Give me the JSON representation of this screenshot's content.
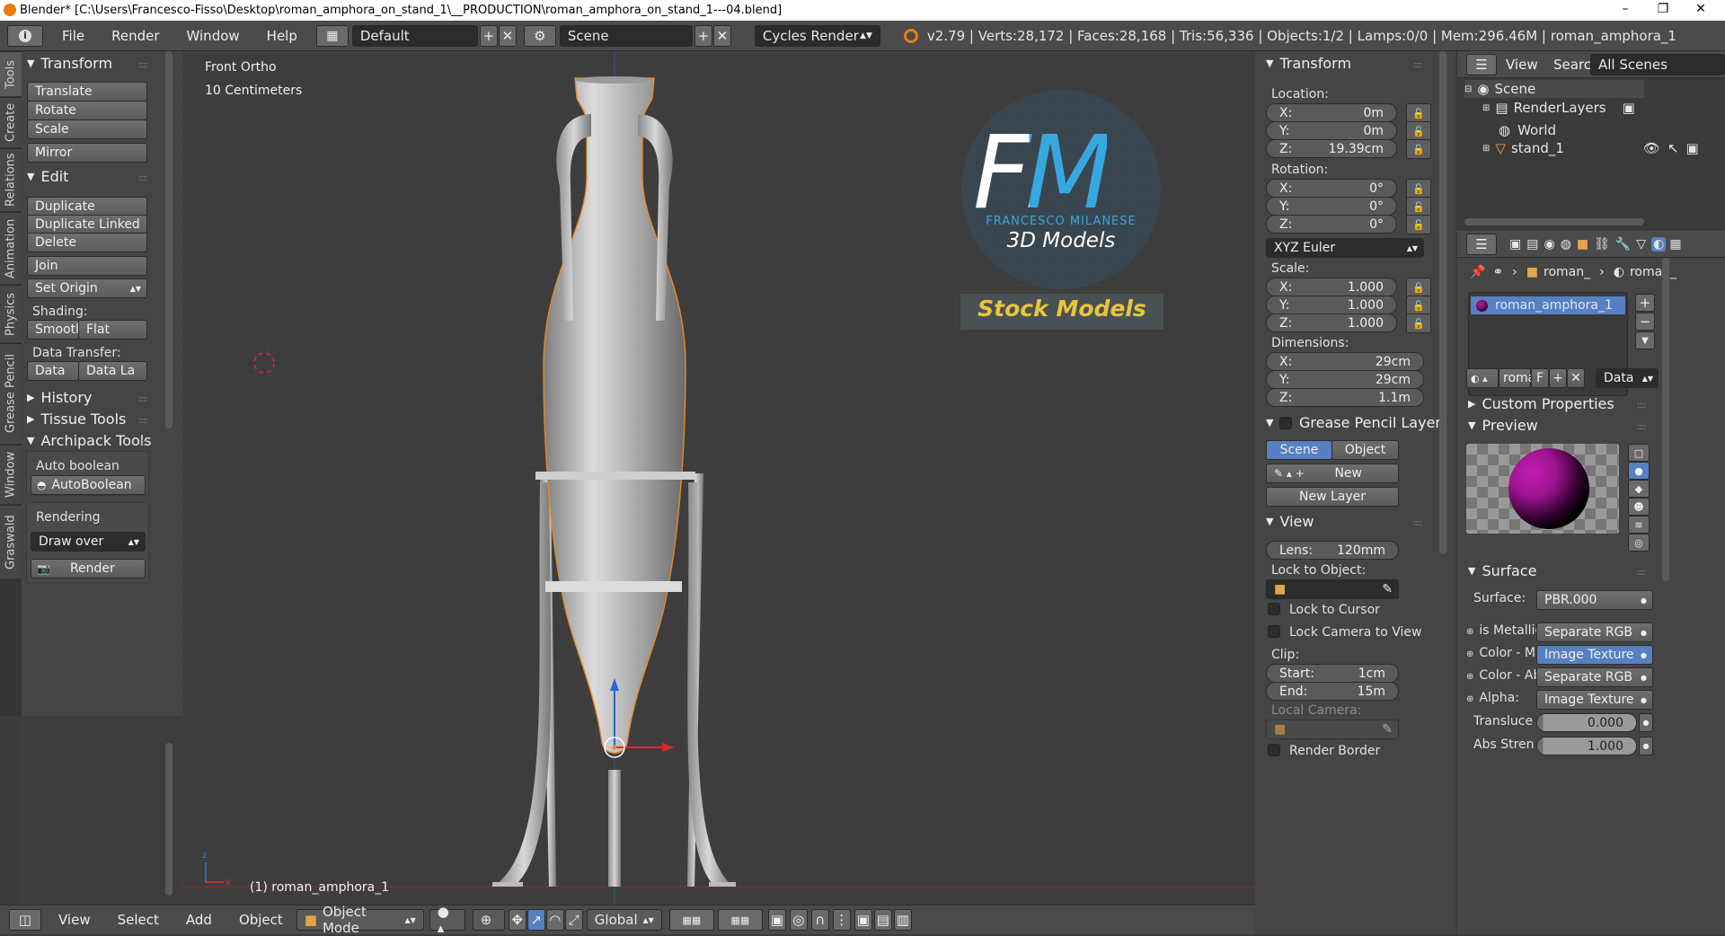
{
  "window": {
    "title": "Blender* [C:\\Users\\Francesco-Fisso\\Desktop\\roman_amphora_on_stand_1\\__PRODUCTION\\roman_amphora_on_stand_1---04.blend]",
    "controls": [
      "–",
      "❐",
      "✕"
    ]
  },
  "topbar": {
    "menus": [
      "File",
      "Render",
      "Window",
      "Help"
    ],
    "layout": "Default",
    "scene": "Scene",
    "engine": "Cycles Render",
    "stats": "v2.79 | Verts:28,172 | Faces:28,168 | Tris:56,336 | Objects:1/2 | Lamps:0/0 | Mem:296.46M | roman_amphora_1"
  },
  "left_tabs": [
    "Tools",
    "Create",
    "Relations",
    "Animation",
    "Physics",
    "Grease Pencil",
    "Window",
    "Graswald"
  ],
  "tool_shelf": {
    "transform": {
      "title": "Transform",
      "buttons": [
        "Translate",
        "Rotate",
        "Scale",
        "Mirror"
      ]
    },
    "edit": {
      "title": "Edit",
      "buttons": [
        "Duplicate",
        "Duplicate Linked",
        "Delete",
        "Join"
      ],
      "set_origin": "Set Origin",
      "shading_label": "Shading:",
      "smooth": "Smooth",
      "flat": "Flat",
      "data_transfer_label": "Data Transfer:",
      "data": "Data",
      "data_la": "Data La"
    },
    "history": "History",
    "tissue": "Tissue Tools",
    "archipack": {
      "title": "Archipack Tools",
      "auto_boolean_label": "Auto boolean",
      "auto_boolean_btn": "AutoBoolean",
      "rendering_label": "Rendering",
      "draw_over": "Draw over",
      "render_btn": "Render"
    }
  },
  "viewport": {
    "view_name": "Front Ortho",
    "scale": "10 Centimeters",
    "object_label": "(1) roman_amphora_1",
    "logo": {
      "letters": "FM",
      "brand": "FRANCESCO MILANESE",
      "sub": "3D Models",
      "banner": "Stock Models"
    }
  },
  "n_panel": {
    "transform_title": "Transform",
    "location_label": "Location:",
    "location": {
      "x": "0m",
      "y": "0m",
      "z": "19.39cm"
    },
    "rotation_label": "Rotation:",
    "rotation": {
      "x": "0°",
      "y": "0°",
      "z": "0°"
    },
    "rotation_mode": "XYZ Euler",
    "scale_label": "Scale:",
    "scale": {
      "x": "1.000",
      "y": "1.000",
      "z": "1.000"
    },
    "dimensions_label": "Dimensions:",
    "dimensions": {
      "x": "29cm",
      "y": "29cm",
      "z": "1.1m"
    },
    "axis": {
      "x": "X:",
      "y": "Y:",
      "z": "Z:"
    },
    "grease_title": "Grease Pencil Layer",
    "grease_tabs": [
      "Scene",
      "Object"
    ],
    "new": "New",
    "new_layer": "New Layer",
    "view_title": "View",
    "lens_label": "Lens:",
    "lens_value": "120mm",
    "lock_object_label": "Lock to Object:",
    "lock_cursor": "Lock to Cursor",
    "lock_camera": "Lock Camera to View",
    "clip_label": "Clip:",
    "clip_start_label": "Start:",
    "clip_start": "1cm",
    "clip_end_label": "End:",
    "clip_end": "15m",
    "local_camera": "Local Camera:",
    "render_border": "Render Border"
  },
  "outliner": {
    "menus": [
      "View",
      "Search"
    ],
    "filter": "All Scenes",
    "tree": [
      "Scene",
      "RenderLayers",
      "World",
      "stand_1"
    ]
  },
  "properties": {
    "breadcrumb": [
      "roman_",
      "roman_"
    ],
    "material_slot": "roman_amphora_1",
    "material_name": "roma",
    "material_f": "F",
    "data_dropdown": "Data",
    "custom_props": "Custom Properties",
    "preview": "Preview",
    "surface_title": "Surface",
    "surface_label": "Surface:",
    "surface_value": "PBR.000",
    "rows": [
      {
        "label": "is Metallic",
        "value": "Separate RGB"
      },
      {
        "label": "Color - Ma",
        "value": "Image Texture"
      },
      {
        "label": "Color - Ab",
        "value": "Separate RGB"
      },
      {
        "label": "Alpha:",
        "value": "Image Texture"
      }
    ],
    "transluce_label": "Transluce",
    "transluce_value": "0.000",
    "abs_label": "Abs Stren",
    "abs_value": "1.000"
  },
  "bottombar": {
    "menus": [
      "View",
      "Select",
      "Add",
      "Object"
    ],
    "mode": "Object Mode",
    "orientation": "Global"
  },
  "colors": {
    "accent": "#5680c2",
    "selection_orange": "#e08a2c",
    "logo_blue": "#37a7e0",
    "logo_yellow": "#e8c53c"
  }
}
